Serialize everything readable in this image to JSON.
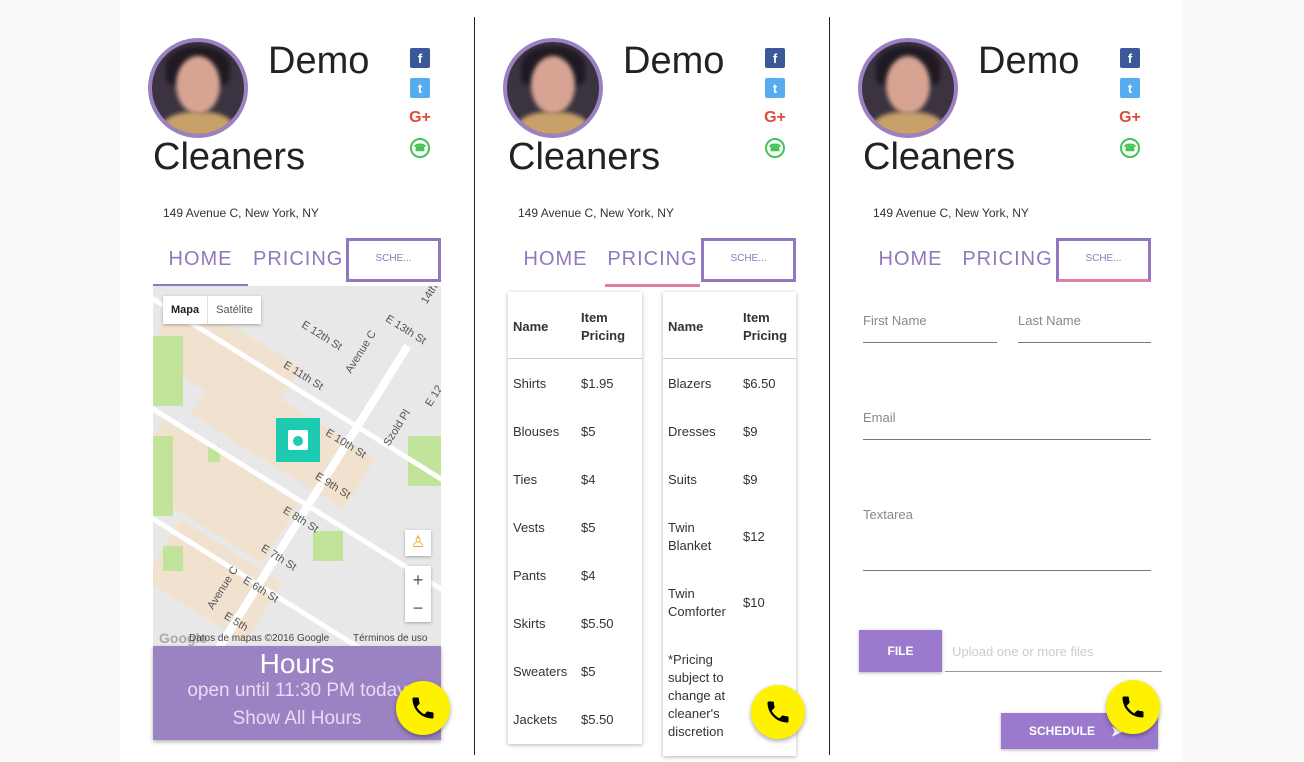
{
  "business": {
    "name_line1": "Demo",
    "name_line2": "Cleaners",
    "address": "149 Avenue C, New York, NY"
  },
  "social": {
    "facebook": "f",
    "twitter": "t",
    "googleplus": "G+",
    "whatsapp": "☎"
  },
  "tabs": {
    "home": "HOME",
    "pricing": "PRICING",
    "schedule": "SCHE..."
  },
  "map": {
    "type_map": "Mapa",
    "type_satellite": "Satélite",
    "streets": [
      "E 12th St",
      "E 13th St",
      "E 11th St",
      "Avenue C",
      "E 10th St",
      "Szold Pl",
      "E 9th St",
      "E 8th St",
      "E 7th St",
      "E 6th St",
      "Avenue C",
      "E 5th",
      "14th",
      "E 12"
    ],
    "zoom_in": "+",
    "zoom_out": "−",
    "logo": "Google",
    "copyright": "Datos de mapas ©2016 Google",
    "terms": "Términos de uso"
  },
  "hours": {
    "title": "Hours",
    "status": "open until 11:30 PM today",
    "show_all": "Show All Hours"
  },
  "pricing": {
    "header_name": "Name",
    "header_price_line1": "Item",
    "header_price_line2": "Pricing",
    "left": [
      {
        "name": "Shirts",
        "price": "$1.95"
      },
      {
        "name": "Blouses",
        "price": "$5"
      },
      {
        "name": "Ties",
        "price": "$4"
      },
      {
        "name": "Vests",
        "price": "$5"
      },
      {
        "name": "Pants",
        "price": "$4"
      },
      {
        "name": "Skirts",
        "price": "$5.50"
      },
      {
        "name": "Sweaters",
        "price": "$5"
      },
      {
        "name": "Jackets",
        "price": "$5.50"
      }
    ],
    "right": [
      {
        "name": "Blazers",
        "price": "$6.50"
      },
      {
        "name": "Dresses",
        "price": "$9"
      },
      {
        "name": "Suits",
        "price": "$9"
      },
      {
        "name": "Twin Blanket",
        "name_l1": "Twin",
        "name_l2": "Blanket",
        "price": "$12"
      },
      {
        "name": "Twin Comforter",
        "name_l1": "Twin",
        "name_l2": "Comforter",
        "price": "$10"
      }
    ],
    "note_lines": [
      "*Pricing",
      "subject to",
      "change at",
      "cleaner's",
      "discretion"
    ]
  },
  "form": {
    "first_name": "First Name",
    "last_name": "Last Name",
    "email": "Email",
    "textarea": "Textarea",
    "file_button": "FILE",
    "upload_placeholder": "Upload one or more files",
    "schedule_button": "SCHEDULE"
  },
  "colors": {
    "accent": "#9178bd",
    "button": "#9b79cd",
    "hours_bg": "#9b82c3",
    "fab": "#fff200",
    "marker": "#1ccbb1",
    "active_underline_pink": "#e57ba8"
  }
}
